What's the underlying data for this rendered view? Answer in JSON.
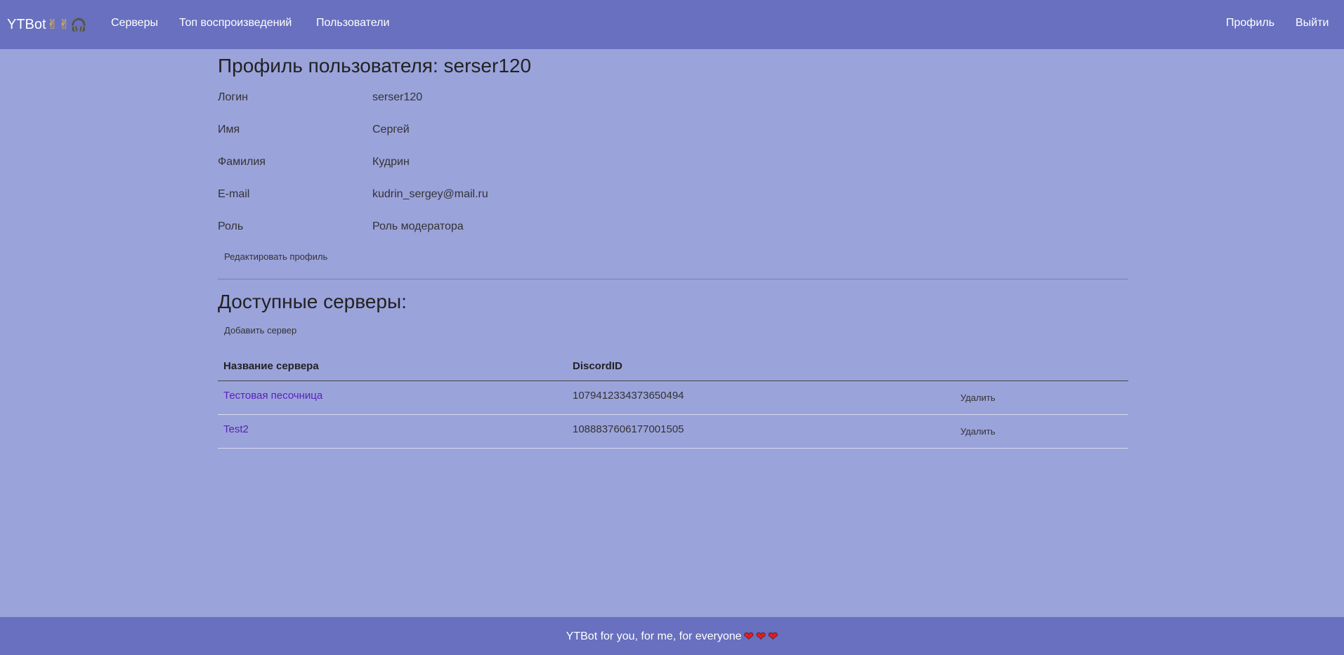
{
  "navbar": {
    "brand": "YTBot",
    "brand_emoji_1": "✌",
    "brand_emoji_2": "✌",
    "brand_emoji_3": "🎧",
    "links": [
      "Серверы",
      "Топ воспроизведений",
      "Пользователи"
    ],
    "profile": "Профиль",
    "logout": "Выйти"
  },
  "profile": {
    "title": "Профиль пользователя: serser120",
    "fields": [
      {
        "label": "Логин",
        "value": "serser120"
      },
      {
        "label": "Имя",
        "value": "Сергей"
      },
      {
        "label": "Фамилия",
        "value": "Кудрин"
      },
      {
        "label": "E-mail",
        "value": "kudrin_sergey@mail.ru"
      },
      {
        "label": "Роль",
        "value": "Роль модератора"
      }
    ],
    "edit_button": "Редактировать профиль"
  },
  "servers": {
    "title": "Доступные серверы:",
    "add_button": "Добавить сервер",
    "columns": [
      "Название сервера",
      "DiscordID"
    ],
    "rows": [
      {
        "name": "Тестовая песочница",
        "discord_id": "1079412334373650494",
        "action": "Удалить"
      },
      {
        "name": "Test2",
        "discord_id": "1088837606177001505",
        "action": "Удалить"
      }
    ]
  },
  "footer": {
    "text": "YTBot for you, for me, for everyone",
    "heart": "❤"
  },
  "colors": {
    "navbar": "#6870bf",
    "background": "#9ba3db",
    "link": "#5a22b8"
  }
}
